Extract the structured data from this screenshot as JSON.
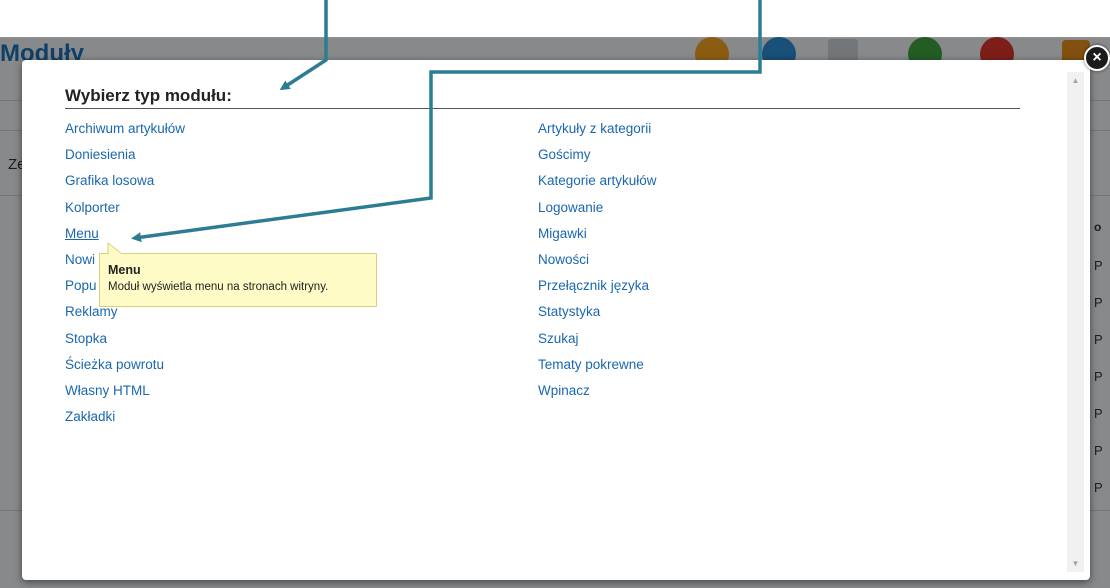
{
  "background_page": {
    "title": "Moduły",
    "side_label": "Ze",
    "right_column_header": "o",
    "right_column_items": [
      "P",
      "P",
      "P",
      "P",
      "P",
      "P",
      "P"
    ]
  },
  "modal": {
    "title": "Wybierz typ modułu:",
    "close_label": "×",
    "scroll_up_label": "▲",
    "scroll_down_label": "▼",
    "left_column": [
      "Archiwum artykułów",
      "Doniesienia",
      "Grafika losowa",
      "Kolporter",
      "Menu",
      "Nowi",
      "Popu",
      "Reklamy",
      "Stopka",
      "Ścieżka powrotu",
      "Własny HTML",
      "Zakładki"
    ],
    "right_column": [
      "Artykuły z kategorii",
      "Gościmy",
      "Kategorie artykułów",
      "Logowanie",
      "Migawki",
      "Nowości",
      "Przełącznik języka",
      "Statystyka",
      "Szukaj",
      "Tematy pokrewne",
      "Wpinacz"
    ],
    "hovered_item": "Menu"
  },
  "tooltip": {
    "title": "Menu",
    "description": "Moduł wyświetla menu na stronach witryny."
  },
  "colors": {
    "link": "#1a67b0",
    "arrow": "#2c7d93",
    "tooltip_bg": "#fffbc7",
    "overlay": "rgba(0,0,0,0.42)"
  }
}
